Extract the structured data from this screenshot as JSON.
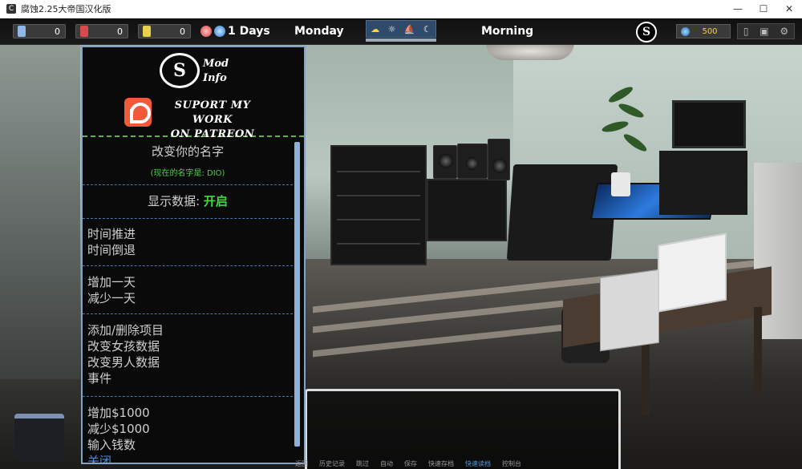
{
  "window": {
    "title": "腐蚀2.25大帝国汉化版",
    "app_icon": "C",
    "controls": {
      "minimize": "—",
      "maximize": "☐",
      "close": "✕"
    }
  },
  "hud": {
    "stats": [
      {
        "icon": "blue-bottle-icon",
        "color": "#8fb8e8",
        "value": "0"
      },
      {
        "icon": "red-bottle-icon",
        "color": "#d84b4b",
        "value": "0"
      },
      {
        "icon": "yellow-bottle-icon",
        "color": "#e8d24b",
        "value": "0"
      }
    ],
    "days": "1 Days",
    "weekday": "Monday",
    "time_of_day_icons": [
      "☁",
      "☼",
      "⛵",
      "☾"
    ],
    "time_of_day": "Morning",
    "logo": "S",
    "money": "500",
    "right_icons": [
      "▯",
      "▣",
      "⚙"
    ]
  },
  "mod_panel": {
    "logo": "S",
    "mod_info": [
      "Mod",
      "Info"
    ],
    "support": [
      "SUPORT MY WORK",
      "ON PATREON"
    ],
    "change_name": "改变你的名字",
    "current_name": "(现在的名字是: DIO)",
    "show_data_label": "显示数据: ",
    "show_data_value": "开启",
    "time_forward": "时间推进",
    "time_back": "时间倒退",
    "add_day": "增加一天",
    "sub_day": "减少一天",
    "add_remove_items": "添加/删除项目",
    "edit_girl": "改变女孩数据",
    "edit_man": "改变男人数据",
    "events": "事件",
    "add_money": "增加$1000",
    "sub_money": "减少$1000",
    "enter_money": "输入钱数",
    "close": "关闭"
  },
  "quick_menu": [
    "返回",
    "历史记录",
    "跳过",
    "自动",
    "保存",
    "快速存档",
    "快速读档",
    "控制台"
  ],
  "colors": {
    "panel_border": "#7fa3c9",
    "accent_green": "#3fdc3f",
    "link_blue": "#4b8ed9"
  }
}
